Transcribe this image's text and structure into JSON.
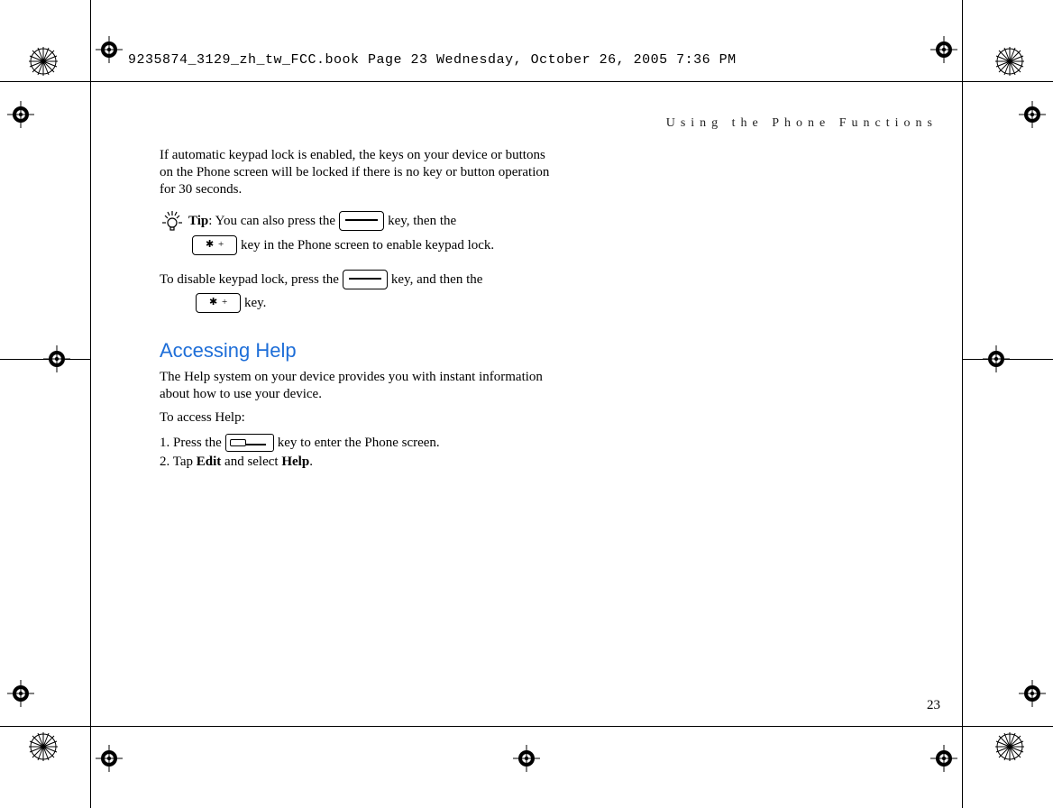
{
  "slug": "9235874_3129_zh_tw_FCC.book  Page 23  Wednesday, October 26, 2005  7:36 PM",
  "header": "Using the Phone Functions",
  "body": {
    "p1": "If automatic keypad lock is enabled, the keys on your device or buttons on the Phone screen will be locked if there is no key or button operation for 30 seconds.",
    "tip_label": "Tip",
    "tip_a": ": You can also press the ",
    "tip_b": " key, then the ",
    "tip_c": " key in the Phone screen to enable keypad lock.",
    "disable_a": "To disable keypad lock, press the ",
    "disable_b": " key, and then the ",
    "disable_c": " key.",
    "h2": "Accessing Help",
    "p2": "The Help system on your device provides you with instant information about how to use your device.",
    "p3": "To access Help:",
    "step1a": "1. Press the ",
    "step1b": " key to enter the Phone screen.",
    "step2a": "2. Tap ",
    "step2_edit": "Edit",
    "step2b": " and select ",
    "step2_help": "Help",
    "step2c": "."
  },
  "page_number": "23"
}
